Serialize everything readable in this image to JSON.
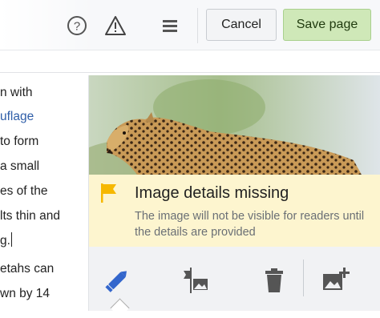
{
  "toolbar": {
    "icons": [
      "help-icon",
      "warning-icon",
      "menu-icon"
    ],
    "cancel_label": "Cancel",
    "save_label": "Save page"
  },
  "article": {
    "lines": [
      "n with",
      "uflage",
      "to form",
      "a small",
      "es of the",
      "lts thin and",
      "g.",
      "etahs can",
      "wn by 14"
    ]
  },
  "popup": {
    "image_alt": "cheetah photo",
    "notice_title": "Image details missing",
    "notice_text": "The image will not be visible for readers until the details are provided",
    "actions": [
      "pencil-icon",
      "caption-flag-icon",
      "trash-icon",
      "add-image-icon"
    ]
  },
  "colors": {
    "save_bg": "#cfe8b8",
    "notice_bg": "#fdf5cf",
    "link": "#2f5ea8",
    "accent_blue": "#3366cc",
    "flag": "#f6b800"
  }
}
